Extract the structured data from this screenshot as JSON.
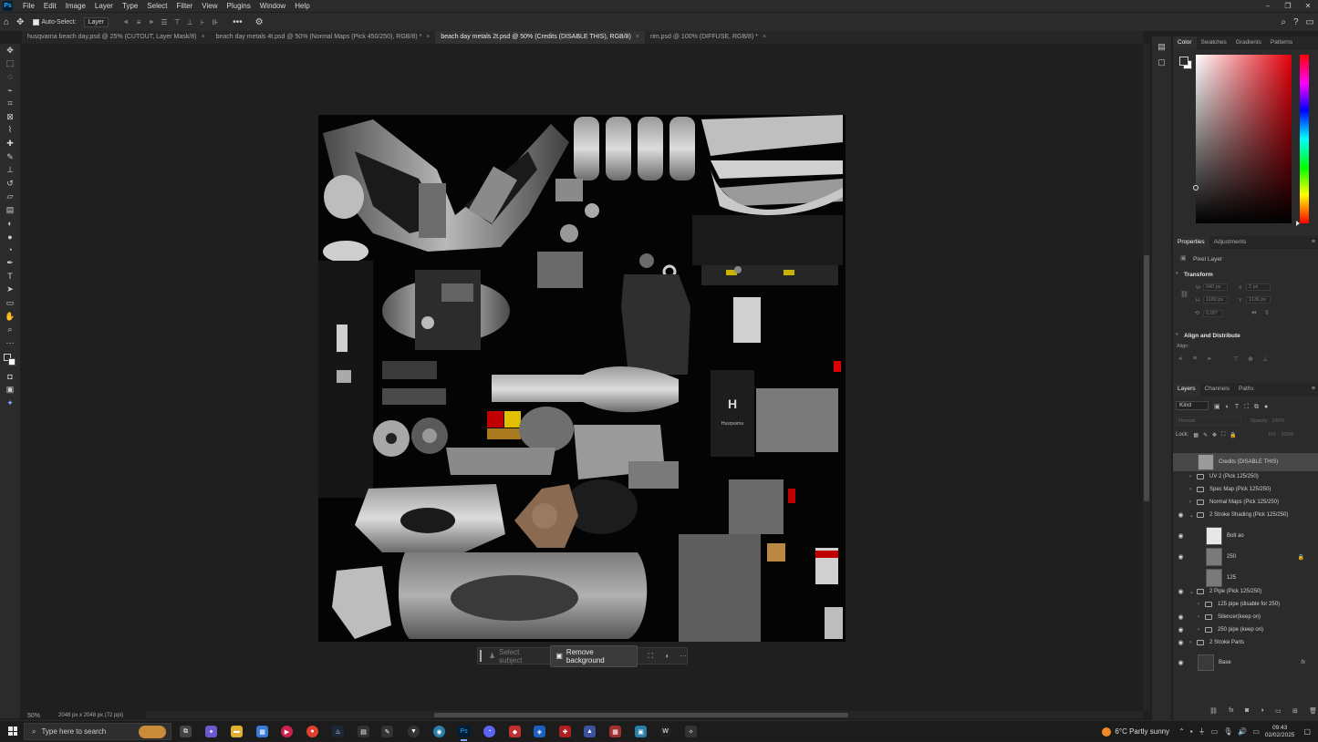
{
  "menubar": {
    "logo": "Ps",
    "items": [
      "File",
      "Edit",
      "Image",
      "Layer",
      "Type",
      "Select",
      "Filter",
      "View",
      "Plugins",
      "Window",
      "Help"
    ]
  },
  "options": {
    "auto_select_label": "Auto-Select:",
    "auto_select_target": "Layer"
  },
  "tabs": [
    {
      "label": "husqvarna beach day.psd @ 25% (CUTOUT, Layer Mask/8)",
      "active": false
    },
    {
      "label": "beach day metals 4t.psd @ 50% (Normal Maps (Pick 450/250), RGB/8) *",
      "active": false
    },
    {
      "label": "beach day metals 2t.psd @ 50% (Credits (DISABLE THIS), RGB/8)",
      "active": true
    },
    {
      "label": "rim.psd @ 100% (DIFFUSE, RGB/8) *",
      "active": false
    }
  ],
  "status": {
    "zoom": "50%",
    "doc_size": "2048 px x 2048 px (72 ppi)"
  },
  "context_bar": {
    "select_subject": "Select subject",
    "remove_background": "Remove background"
  },
  "color_panel": {
    "tabs": [
      "Color",
      "Swatches",
      "Gradients",
      "Patterns"
    ],
    "active_tab": "Color",
    "hue_color": "#e3000b"
  },
  "properties": {
    "tabs": [
      "Properties",
      "Adjustments"
    ],
    "layer_type": "Pixel Layer",
    "transform_title": "Transform",
    "w": "940 px",
    "x": "2 px",
    "h": "1180 px",
    "y": "1136 px",
    "angle": "0.00°",
    "align_title": "Align and Distribute",
    "align_label": "Align:"
  },
  "layers_panel": {
    "tabs": [
      "Layers",
      "Channels",
      "Paths"
    ],
    "kind_label": "Kind",
    "blend_mode": "Normal",
    "opacity_label": "Opacity:",
    "opacity_value": "100%",
    "lock_label": "Lock:",
    "fill_label": "Fill:",
    "fill_value": "100%",
    "layers": [
      {
        "name": "Credits (DISABLE THIS)",
        "visible": false,
        "type": "pixel",
        "indent": 0,
        "selected": true
      },
      {
        "name": "UV 2 (Pick 125/250)",
        "visible": false,
        "type": "group",
        "indent": 0
      },
      {
        "name": "Spec Map (Pick 125/250)",
        "visible": false,
        "type": "group",
        "indent": 0
      },
      {
        "name": "Normal Maps (Pick 125/250)",
        "visible": false,
        "type": "group",
        "indent": 0
      },
      {
        "name": "2 Stroke Shading (Pick 125/250)",
        "visible": true,
        "type": "group-open",
        "indent": 0
      },
      {
        "name": "Bolt ao",
        "visible": true,
        "type": "pixel",
        "indent": 1
      },
      {
        "name": "250",
        "visible": true,
        "type": "pixel",
        "indent": 1,
        "locked": true
      },
      {
        "name": "125",
        "visible": false,
        "type": "pixel",
        "indent": 1
      },
      {
        "name": "2 Pipe (Pick 125/250)",
        "visible": true,
        "type": "group-open",
        "indent": 0
      },
      {
        "name": "125 pipe (disable for 250)",
        "visible": false,
        "type": "group",
        "indent": 1
      },
      {
        "name": "Silencer(keep on)",
        "visible": true,
        "type": "group",
        "indent": 1
      },
      {
        "name": "250 pipe (keep on)",
        "visible": true,
        "type": "group",
        "indent": 1
      },
      {
        "name": "2 Stroke Parts",
        "visible": true,
        "type": "group",
        "indent": 0
      },
      {
        "name": "Base",
        "visible": true,
        "type": "pixel",
        "indent": 0,
        "fx": true
      }
    ]
  },
  "texture": {
    "brand_text": "Husqvarna"
  },
  "taskbar": {
    "search_placeholder": "Type here to search",
    "weather": "6°C  Partly sunny",
    "time": "09:43",
    "date": "02/02/2025"
  }
}
